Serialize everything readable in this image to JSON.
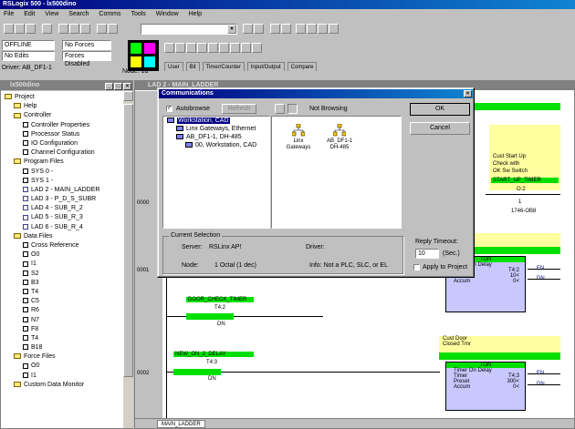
{
  "app": {
    "title": "RSLogix 500 - lx500dino",
    "menu": [
      "File",
      "Edit",
      "View",
      "Search",
      "Comms",
      "Tools",
      "Window",
      "Help"
    ]
  },
  "status_panel": {
    "mode": "OFFLINE",
    "edits": "No Edits",
    "forces": "No Forces",
    "forces_state": "Forces Disabled",
    "driver": "Driver: AB_DF1-1",
    "node": "Node: 1d"
  },
  "instruction_tabs": [
    "User",
    "Bit",
    "Timer/Counter",
    "Input/Output",
    "Compare"
  ],
  "project_window": {
    "title": "lx500dino",
    "items": [
      {
        "label": "Project",
        "depth": 0,
        "icon": "folder"
      },
      {
        "label": "Help",
        "depth": 1,
        "icon": "folder"
      },
      {
        "label": "Controller",
        "depth": 1,
        "icon": "folder"
      },
      {
        "label": "Controller Properties",
        "depth": 2,
        "icon": "file"
      },
      {
        "label": "Processor Status",
        "depth": 2,
        "icon": "file"
      },
      {
        "label": "IO Configuration",
        "depth": 2,
        "icon": "file"
      },
      {
        "label": "Channel Configuration",
        "depth": 2,
        "icon": "file"
      },
      {
        "label": "Program Files",
        "depth": 1,
        "icon": "folder"
      },
      {
        "label": "SYS 0 -",
        "depth": 2,
        "icon": "file"
      },
      {
        "label": "SYS 1 -",
        "depth": 2,
        "icon": "file"
      },
      {
        "label": "LAD 2 - MAIN_LADDER",
        "depth": 2,
        "icon": "rung"
      },
      {
        "label": "LAD 3 - P_D_S_SUBR",
        "depth": 2,
        "icon": "rung"
      },
      {
        "label": "LAD 4 - SUB_R_2",
        "depth": 2,
        "icon": "rung"
      },
      {
        "label": "LAD 5 - SUB_R_3",
        "depth": 2,
        "icon": "rung"
      },
      {
        "label": "LAD 6 - SUB_R_4",
        "depth": 2,
        "icon": "rung"
      },
      {
        "label": "Data Files",
        "depth": 1,
        "icon": "folder"
      },
      {
        "label": "Cross Reference",
        "depth": 2,
        "icon": "file"
      },
      {
        "label": "O0",
        "depth": 2,
        "icon": "file"
      },
      {
        "label": "I1",
        "depth": 2,
        "icon": "file"
      },
      {
        "label": "S2",
        "depth": 2,
        "icon": "file"
      },
      {
        "label": "B3",
        "depth": 2,
        "icon": "file"
      },
      {
        "label": "T4",
        "depth": 2,
        "icon": "file"
      },
      {
        "label": "C5",
        "depth": 2,
        "icon": "file"
      },
      {
        "label": "R6",
        "depth": 2,
        "icon": "file"
      },
      {
        "label": "N7",
        "depth": 2,
        "icon": "file"
      },
      {
        "label": "F8",
        "depth": 2,
        "icon": "file"
      },
      {
        "label": "T4",
        "depth": 2,
        "icon": "file"
      },
      {
        "label": "B18",
        "depth": 2,
        "icon": "file"
      },
      {
        "label": "Force Files",
        "depth": 1,
        "icon": "folder"
      },
      {
        "label": "O0",
        "depth": 2,
        "icon": "file"
      },
      {
        "label": "I1",
        "depth": 2,
        "icon": "file"
      },
      {
        "label": "Custom Data Monitor",
        "depth": 1,
        "icon": "folder"
      }
    ]
  },
  "ladder_window": {
    "title": "LAD 2 - MAIN_LADDER",
    "tab_label": "MAIN_LADDER",
    "rungs": [
      "0000",
      "0001",
      "0002"
    ],
    "labels": {
      "cust_start": "Cust Start Up",
      "check_with": "Check with",
      "ok_sw": "OK Sw Switch",
      "start_up": "START_UP_TIMER",
      "addr_o2": "O:2",
      "addr_1": "1",
      "dev": "1746-OB8",
      "ton": "TON",
      "timer_on_delay": "Timer On Delay",
      "timer": "Timer",
      "timer_val_1": "T4:2",
      "preset": "Preset",
      "preset_val_1": "10<",
      "accum": "Accum",
      "accum_val_1": "0<",
      "en": "EN",
      "dn": "DN",
      "rung1_label": "DOOR_CHECK_TIMER",
      "t42": "T4:2",
      "dn2": "DN",
      "rung2_label": "NEW_ON_2_DELAY",
      "t43": "T4:3",
      "dn3": "DN",
      "cust_door": "Cust Door",
      "closed_tm": "Closed Tmr",
      "timer_val_2": "T4:3",
      "preset_val_2": "300<",
      "accum_val_2": "0<"
    }
  },
  "dialog": {
    "title": "Communications",
    "autobrowse_label": "Autobrowse",
    "refresh_label": "Refresh",
    "not_browsing": "Not Browsing",
    "ok_label": "OK",
    "cancel_label": "Cancel",
    "tree": [
      {
        "label": "Workstation, CAD",
        "depth": 0
      },
      {
        "label": "Linx Gateways, Ethernet",
        "depth": 1
      },
      {
        "label": "AB_DF1-1, DH-485",
        "depth": 1
      },
      {
        "label": "00, Workstation, CAD",
        "depth": 2
      }
    ],
    "devices": [
      {
        "label": "Linx Gateways"
      },
      {
        "label": "AB_DF1-1 DH-485"
      }
    ],
    "current_selection_label": "Current Selection",
    "server_label": "Server:",
    "server_value": "RSLinx AP!",
    "driver_label": "Driver:",
    "driver_value": "",
    "node_label": "Node:",
    "node_value": "1 Octal (1 dec)",
    "info": "Info: Not a PLC, SLC, or EL",
    "reply_timeout_label": "Reply Timeout:",
    "reply_timeout_value": "10",
    "sec_label": "(Sec.)",
    "apply_label": "Apply to Project"
  }
}
